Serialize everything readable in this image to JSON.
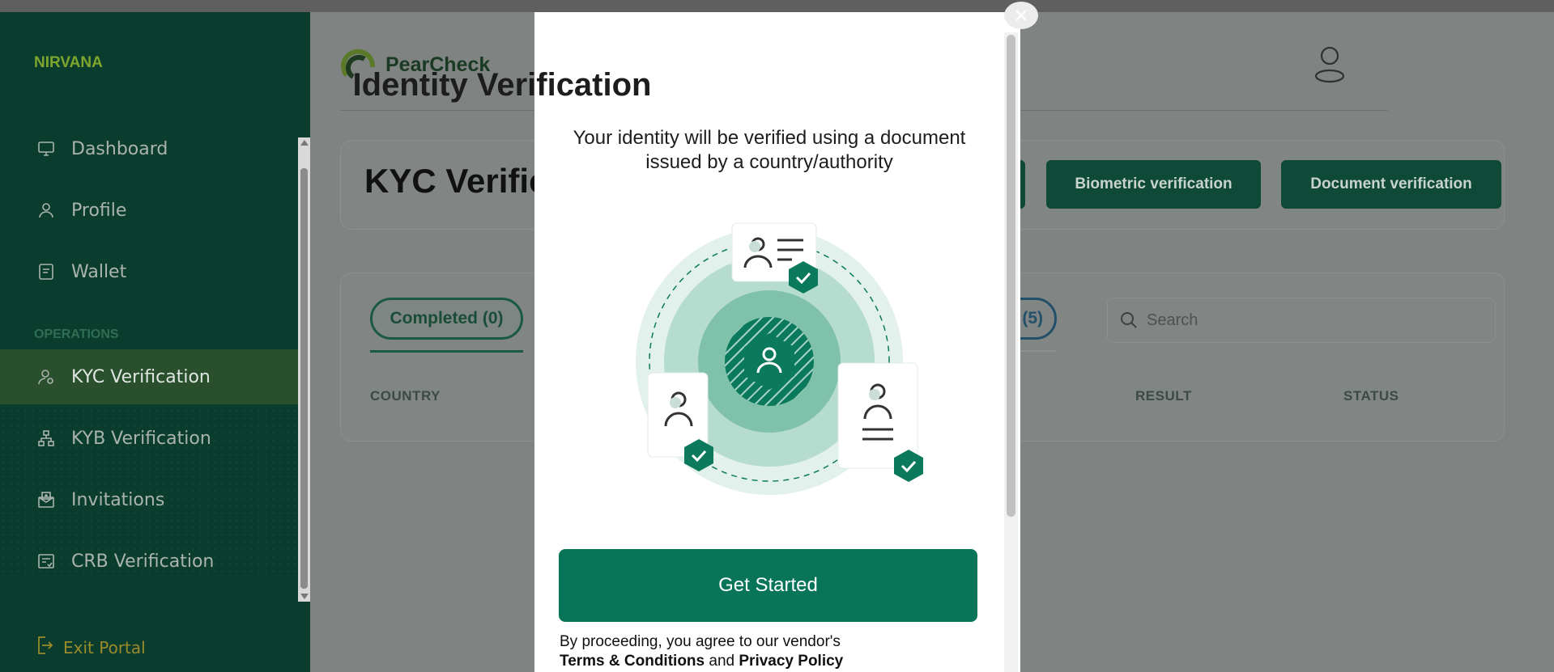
{
  "sidebar": {
    "brand": "NIRVANA",
    "items": [
      {
        "label": "Dashboard",
        "icon": "monitor-icon"
      },
      {
        "label": "Profile",
        "icon": "user-icon"
      },
      {
        "label": "Wallet",
        "icon": "wallet-icon"
      }
    ],
    "section_label": "OPERATIONS",
    "ops_items": [
      {
        "label": "KYC Verification",
        "icon": "kyc-icon",
        "active": true
      },
      {
        "label": "KYB Verification",
        "icon": "org-chart-icon"
      },
      {
        "label": "Invitations",
        "icon": "invitation-icon"
      },
      {
        "label": "CRB Verification",
        "icon": "report-icon"
      }
    ],
    "exit_label": "Exit Portal"
  },
  "header": {
    "logo_text": "PearCheck"
  },
  "page": {
    "title": "KYC Verific",
    "buttons": {
      "biometric": "Biometric verification",
      "document": "Document verification"
    },
    "tabs": {
      "completed": "Completed (0)",
      "partial_count": "(5)"
    },
    "search_placeholder": "Search",
    "columns": {
      "country": "COUNTRY",
      "result": "RESULT",
      "status": "STATUS"
    }
  },
  "modal": {
    "title": "Identity Verification",
    "subtitle": "Your identity will be verified using a document issued by a country/authority",
    "cta": "Get Started",
    "consent_prefix": "By proceeding, you agree to our vendor's",
    "terms": "Terms & Conditions",
    "and": "and",
    "privacy": "Privacy Policy"
  },
  "colors": {
    "sidebar_bg": "#0b3d2e",
    "brand_green": "#7ea62e",
    "cta_green": "#087559",
    "modal_bg": "#ffffff"
  }
}
